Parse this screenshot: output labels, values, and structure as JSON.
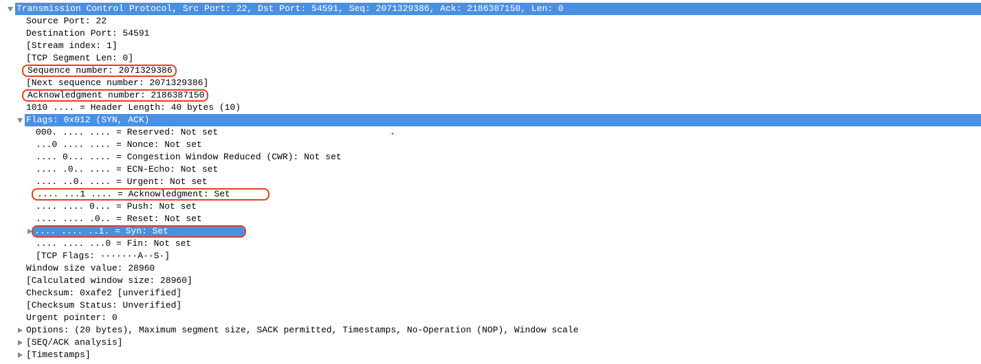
{
  "tcp": {
    "header": "Transmission Control Protocol, Src Port: 22, Dst Port: 54591, Seq: 2071329386, Ack: 2186387150, Len: 0",
    "src_port": "Source Port: 22",
    "dst_port": "Destination Port: 54591",
    "stream_index": "[Stream index: 1]",
    "seg_len": "[TCP Segment Len: 0]",
    "seq_num": "Sequence number: 2071329386",
    "next_seq": "[Next sequence number: 2071329386]",
    "ack_num": "Acknowledgment number: 2186387150",
    "hdr_len": "1010 .... = Header Length: 40 bytes (10)",
    "flags_header": "Flags: 0x012 (SYN, ACK)",
    "flags": {
      "reserved": "000. .... .... = Reserved: Not set",
      "nonce": "...0 .... .... = Nonce: Not set",
      "cwr": ".... 0... .... = Congestion Window Reduced (CWR): Not set",
      "ecn": ".... .0.. .... = ECN-Echo: Not set",
      "urgent": ".... ..0. .... = Urgent: Not set",
      "ack": ".... ...1 .... = Acknowledgment: Set",
      "push": ".... .... 0... = Push: Not set",
      "reset": ".... .... .0.. = Reset: Not set",
      "syn": ".... .... ..1. = Syn: Set",
      "fin": ".... .... ...0 = Fin: Not set",
      "summary": "[TCP Flags: ·······A··S·]"
    },
    "win_size": "Window size value: 28960",
    "calc_win": "[Calculated window size: 28960]",
    "checksum": "Checksum: 0xafe2 [unverified]",
    "checksum_status": "[Checksum Status: Unverified]",
    "urgent_ptr": "Urgent pointer: 0",
    "options": "Options: (20 bytes), Maximum segment size, SACK permitted, Timestamps, No-Operation (NOP), Window scale",
    "seq_ack_analysis": "[SEQ/ACK analysis]",
    "timestamps": "[Timestamps]"
  }
}
